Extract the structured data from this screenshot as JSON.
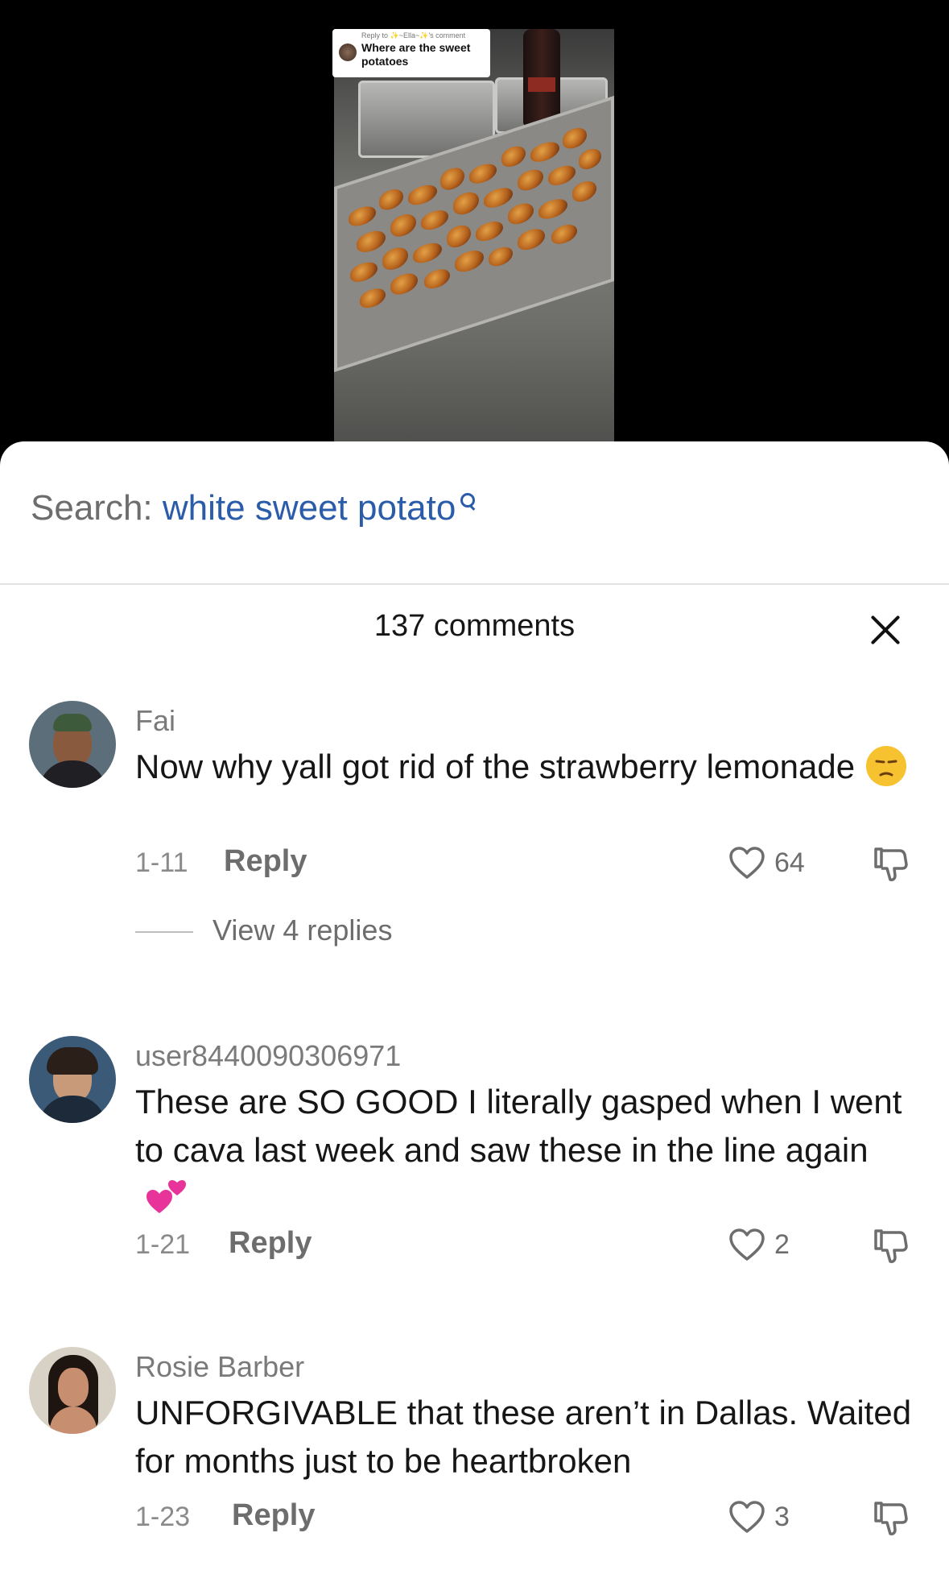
{
  "video": {
    "reply_bubble": {
      "meta": "Reply to ✨~Ella~✨'s comment",
      "text": "Where are the sweet potatoes"
    }
  },
  "search": {
    "label": "Search:",
    "term": "white sweet potato",
    "icon": "search-icon"
  },
  "header": {
    "count_label": "137 comments",
    "close_icon": "close-icon"
  },
  "comments": [
    {
      "username": "Fai",
      "text": "Now why yall got rid of the strawberry lemonade",
      "emoji": "unamused-face",
      "date": "1-11",
      "reply_label": "Reply",
      "likes": "64",
      "view_replies": "View 4 replies"
    },
    {
      "username": "user8440090306971",
      "text": "These are SO GOOD I literally gasped when I went to cava last week and saw these in the line again",
      "emoji": "two-hearts",
      "date": "1-21",
      "reply_label": "Reply",
      "likes": "2"
    },
    {
      "username": "Rosie Barber",
      "text": "UNFORGIVABLE that these aren’t in Dallas. Waited for months just to be heartbroken",
      "date": "1-23",
      "reply_label": "Reply",
      "likes": "3"
    }
  ],
  "colors": {
    "search_term": "#2a5caa",
    "text": "#161616",
    "muted": "#7a7a7a"
  }
}
